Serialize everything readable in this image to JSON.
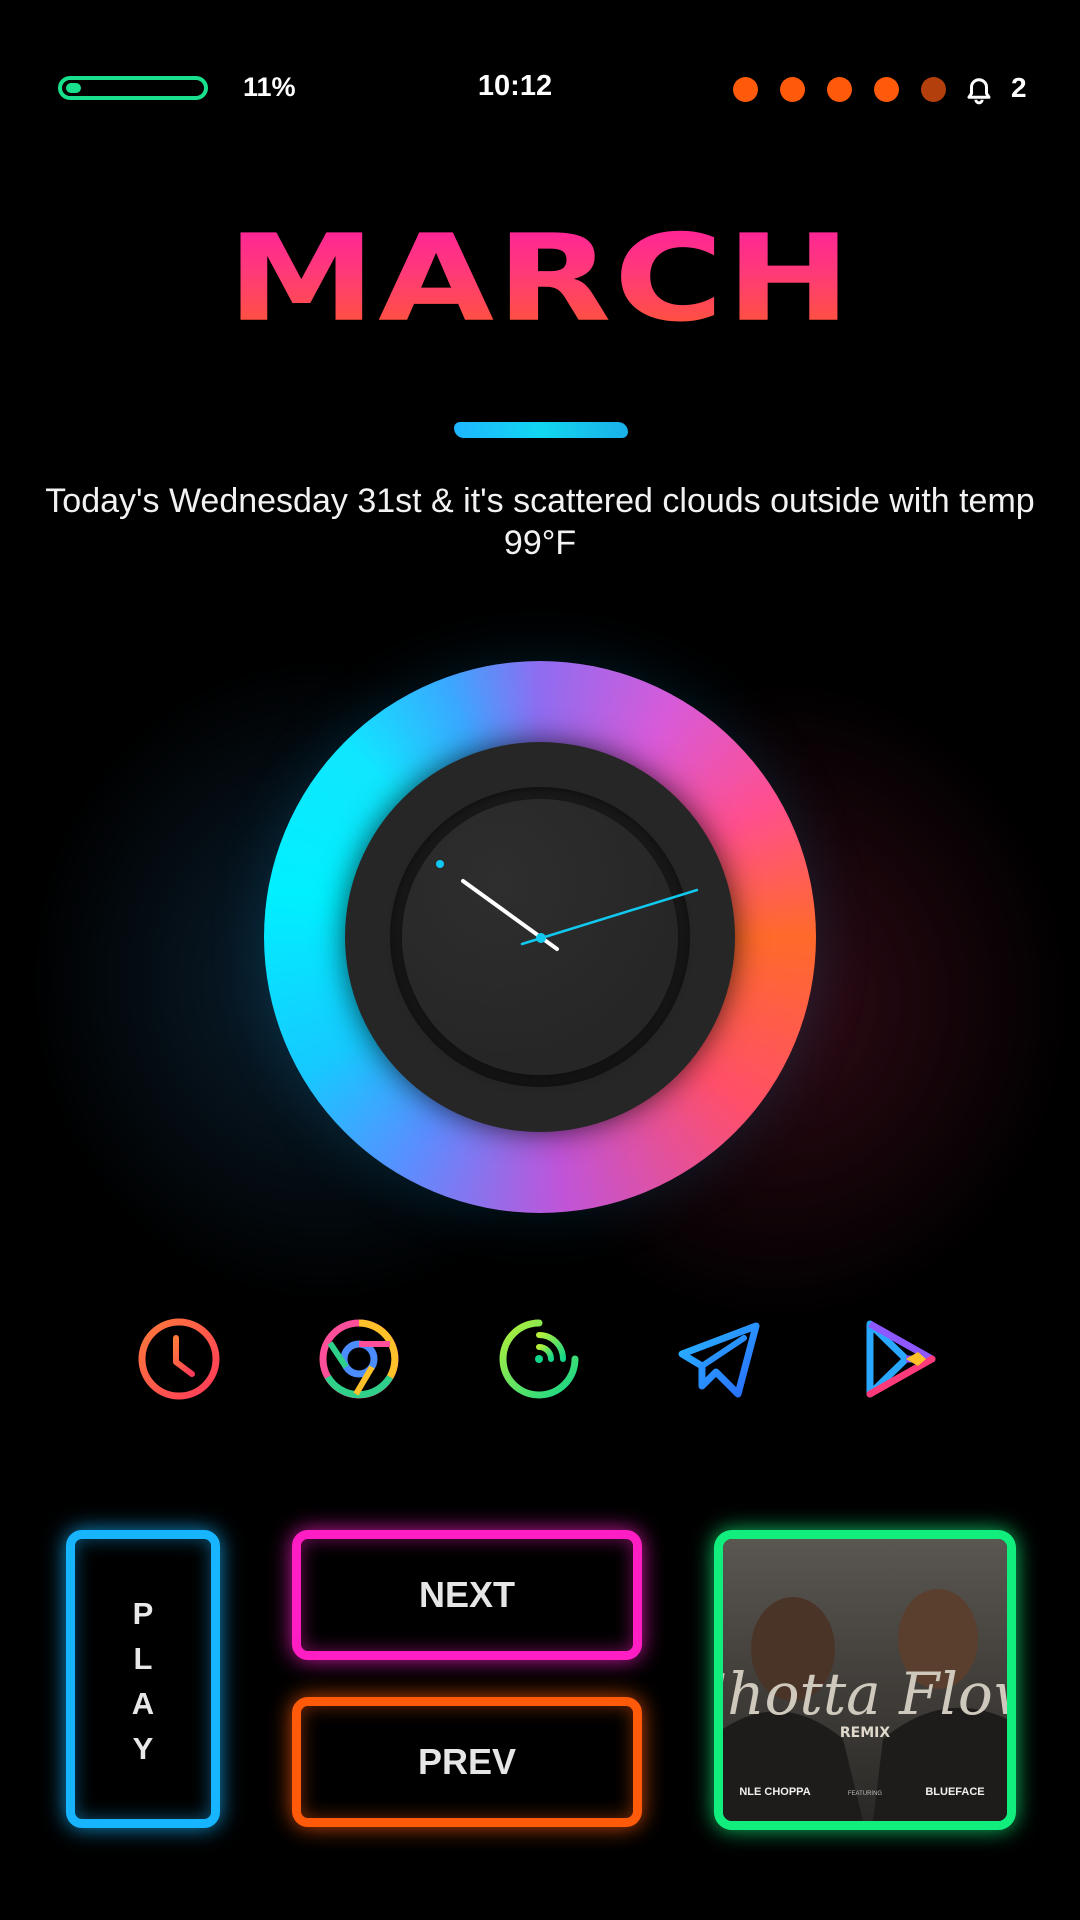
{
  "status_bar": {
    "battery_level": 0.11,
    "battery_text": "11%",
    "time": "10:12",
    "dots": [
      "#ff5a0a",
      "#ff5a0a",
      "#ff5a0a",
      "#ff5a0a",
      "#b3400c"
    ],
    "bell_icon": "bell-icon",
    "notification_count": "2"
  },
  "header": {
    "month": "MARCH",
    "subtitle": "Today's Wednesday 31st & it's scattered clouds outside with temp 99°F"
  },
  "clock": {
    "time": "10:12"
  },
  "apps": [
    {
      "name": "clock-app-icon",
      "color": "#ff5a3a"
    },
    {
      "name": "chrome-icon",
      "color": "#5aa0ff"
    },
    {
      "name": "fitness-app-icon",
      "color": "#3ee07a"
    },
    {
      "name": "telegram-icon",
      "color": "#2b9cff"
    },
    {
      "name": "play-store-icon",
      "color": "#c74fff"
    }
  ],
  "media": {
    "play_letters": [
      "P",
      "L",
      "A",
      "Y"
    ],
    "next_label": "NEXT",
    "prev_label": "PREV",
    "album": {
      "title": "Shotta Flow",
      "tag": "REMIX",
      "artist": "NLE CHOPPA",
      "featuring": "FEATURING",
      "feature_artist": "BLUEFACE"
    }
  },
  "colors": {
    "play_border": "#17b4ff",
    "next_border": "#ff1ec4",
    "prev_border": "#ff5a0a",
    "art_border": "#12ee7e",
    "battery": "#19e08c",
    "brush": "#1eb6ff",
    "second_hand": "#11c9ef"
  }
}
